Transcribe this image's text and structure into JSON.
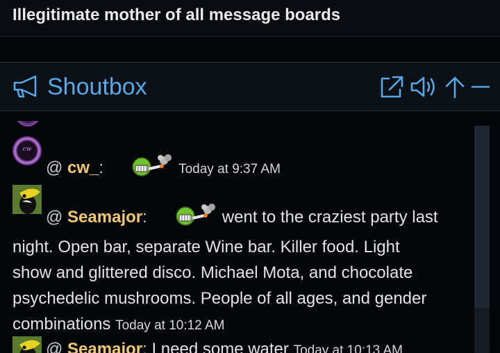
{
  "forum": {
    "title": "Illegitimate mother of all message boards"
  },
  "shoutbox": {
    "title": "Shoutbox",
    "icons": [
      "megaphone-icon",
      "popout-icon",
      "sound-icon",
      "arrow-up-icon",
      "minimize-icon"
    ],
    "accent_color": "#58a8e6",
    "username_color": "#f0c872",
    "messages": [
      {
        "at": "@",
        "user": "cw_",
        "colon": ":",
        "emoji": "smoking-grin-emoji",
        "text": "",
        "time": "Today at 9:37 AM"
      },
      {
        "at": "@",
        "user": "Seamajor",
        "colon": ":",
        "emoji": "smoking-grin-emoji",
        "text_line1": "went to the craziest party last",
        "text_rest": [
          "night. Open bar, separate Wine bar. Killer food. Light",
          "show and glittered disco. Michael Mota, and chocolate",
          "psychedelic mushrooms. People of all ages, and gender"
        ],
        "text_last": "combinations",
        "time": "Today at 10:12 AM"
      },
      {
        "at": "@",
        "user": "Seamajor",
        "colon": ":",
        "text": "I need some water",
        "time": "Today at 10:13 AM"
      }
    ]
  }
}
